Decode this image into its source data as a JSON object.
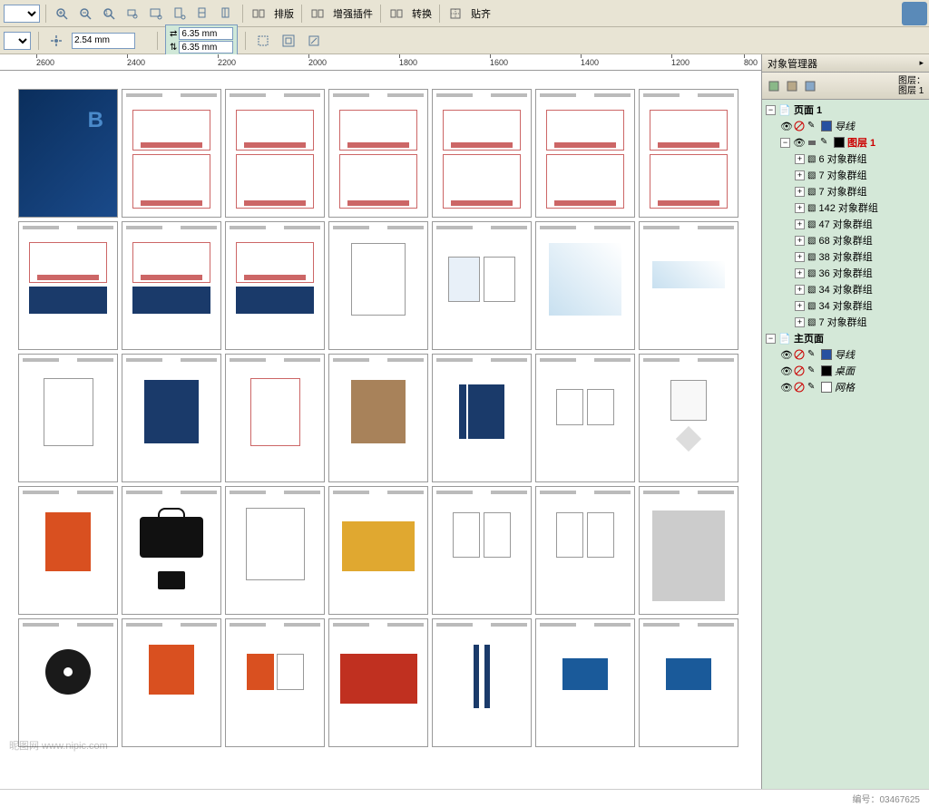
{
  "toolbar": {
    "layout": "排版",
    "enhance_plugin": "增强插件",
    "convert": "转换",
    "align": "贴齐",
    "nudge_value": "2.54 mm",
    "dup_x": "6.35 mm",
    "dup_y": "6.35 mm"
  },
  "ruler": [
    "2600",
    "2400",
    "2200",
    "2000",
    "1800",
    "1600",
    "1400",
    "1200",
    "800"
  ],
  "panel": {
    "title": "对象管理器",
    "layer_label1": "图层：",
    "layer_label2": "图层 1"
  },
  "tree": {
    "page1": "页面 1",
    "guides": "导线",
    "layer1": "图层 1",
    "groups": [
      "6 对象群组",
      "7 对象群组",
      "7 对象群组",
      "142 对象群组",
      "47 对象群组",
      "68 对象群组",
      "38 对象群组",
      "36 对象群组",
      "34 对象群组",
      "34 对象群组",
      "7 对象群组"
    ],
    "master": "主页面",
    "master_guides": "导线",
    "desktop": "桌面",
    "grid": "网格"
  },
  "footer": {
    "watermark": "昵图网 www.nipic.com",
    "id_label": "编号：",
    "id_value": "03467625"
  }
}
